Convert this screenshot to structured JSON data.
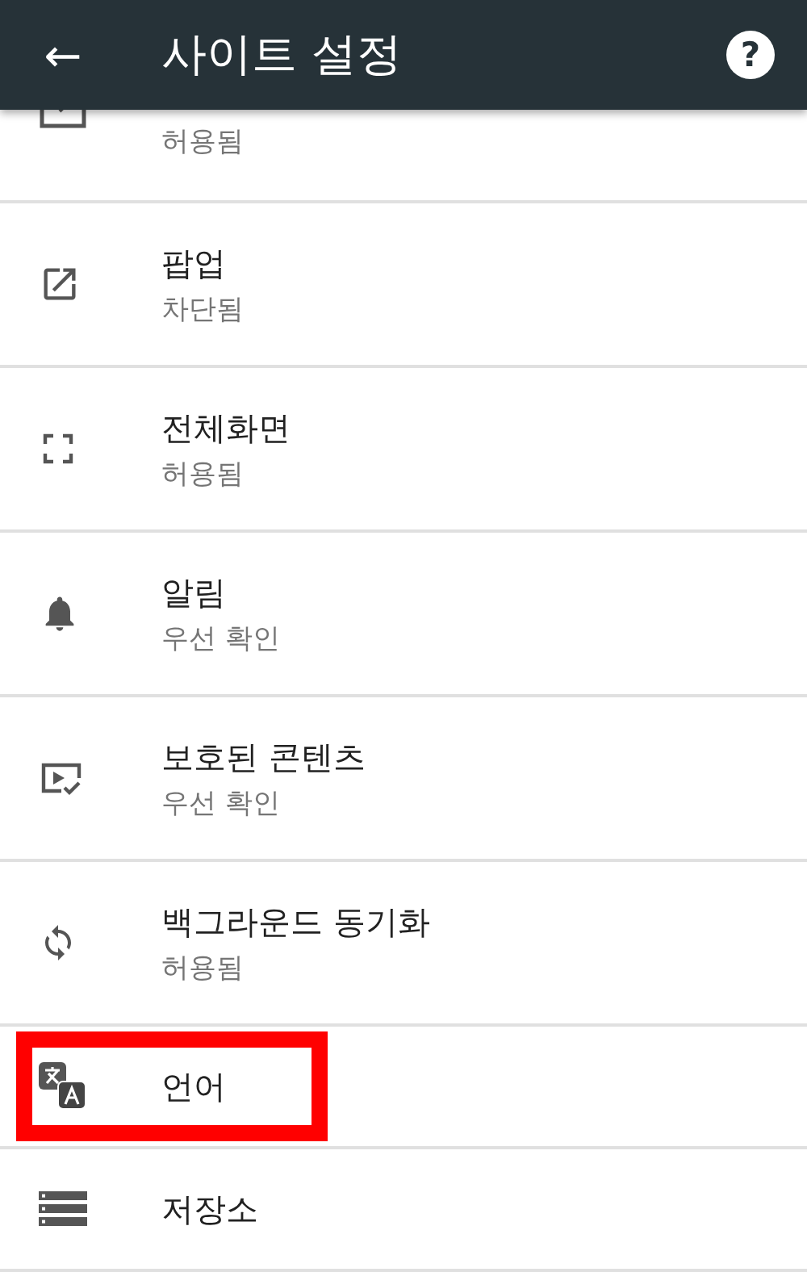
{
  "app_bar": {
    "back": "←",
    "title": "사이트 설정",
    "help": "?"
  },
  "settings": [
    {
      "subtitle": "허용됨",
      "clipped": true
    },
    {
      "title": "팝업",
      "subtitle": "차단됨"
    },
    {
      "title": "전체화면",
      "subtitle": "허용됨"
    },
    {
      "title": "알림",
      "subtitle": "우선 확인"
    },
    {
      "title": "보호된 콘텐츠",
      "subtitle": "우선 확인"
    },
    {
      "title": "백그라운드 동기화",
      "subtitle": "허용됨"
    },
    {
      "title": "언어",
      "highlighted": true
    },
    {
      "title": "저장소"
    }
  ]
}
